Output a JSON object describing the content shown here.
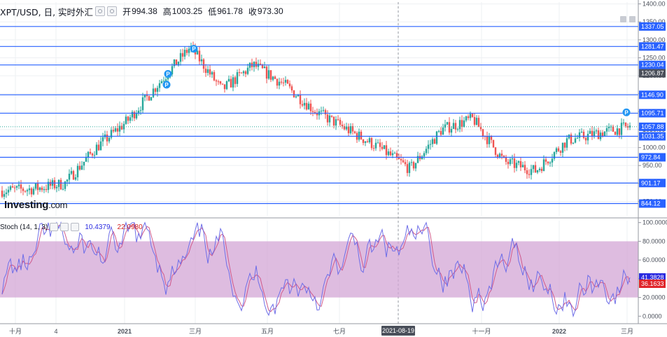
{
  "legend": {
    "symbol": "XPT/USD, 日, 实时外汇",
    "open_label": "开",
    "open": "994.38",
    "high_label": "高",
    "high": "1003.25",
    "low_label": "低",
    "low": "961.78",
    "close_label": "收",
    "close": "973.30"
  },
  "stoch_legend": {
    "name": "Stoch (14, 1, 3)",
    "k": "10.4379",
    "d": "22.0980"
  },
  "logo": {
    "brand": "Investing",
    "domain": ".com"
  },
  "colors": {
    "up": "#26a69a",
    "down": "#ef5350",
    "level": "#2962ff",
    "k_line": "#6e6ee8",
    "d_line": "#d05a8c",
    "band": "#d3a6d6"
  },
  "chart_data": [
    {
      "type": "candlestick",
      "title": "XPT/USD, 日, 实时外汇",
      "y_ticks": [
        850,
        900,
        950,
        1000,
        1050,
        1100,
        1150,
        1200,
        1250,
        1300,
        1350,
        1400
      ],
      "ylim": [
        810,
        1405
      ],
      "x_ticks": [
        "十月",
        "4",
        "2021",
        "三月",
        "五月",
        "七月",
        "2021-08-19",
        "十一月",
        "2022",
        "三月"
      ],
      "horizontal_levels": [
        1337.05,
        1281.47,
        1230.04,
        1146.9,
        1095.71,
        1031.35,
        972.84,
        901.17,
        844.12
      ],
      "last_price_labels": [
        1206.87,
        1057.88
      ],
      "approx_close_path": [
        {
          "x": "十月",
          "y": 880
        },
        {
          "x": "4",
          "y": 885
        },
        {
          "x": "",
          "y": 900
        },
        {
          "x": "",
          "y": 1000
        },
        {
          "x": "2021",
          "y": 1075
        },
        {
          "x": "",
          "y": 1180
        },
        {
          "x": "三月",
          "y": 1280
        },
        {
          "x": "",
          "y": 1160
        },
        {
          "x": "五月",
          "y": 1230
        },
        {
          "x": "",
          "y": 1175
        },
        {
          "x": "七月",
          "y": 1100
        },
        {
          "x": "",
          "y": 1050
        },
        {
          "x": "2021-08-19",
          "y": 1000
        },
        {
          "x": "",
          "y": 940
        },
        {
          "x": "",
          "y": 1050
        },
        {
          "x": "十一月",
          "y": 1080
        },
        {
          "x": "",
          "y": 960
        },
        {
          "x": "",
          "y": 935
        },
        {
          "x": "2022",
          "y": 1020
        },
        {
          "x": "",
          "y": 1040
        },
        {
          "x": "三月",
          "y": 1057.88
        }
      ]
    },
    {
      "type": "line",
      "title": "Stoch (14, 1, 3)",
      "y_ticks": [
        "100.0000",
        "80.0000",
        "60.0000",
        "40.0000",
        "20.0000",
        "0.0000"
      ],
      "ylim": [
        -8,
        102
      ],
      "band": [
        20,
        80
      ],
      "series": [
        {
          "name": "10.4379",
          "last": 41.3828
        },
        {
          "name": "22.0980",
          "last": 36.1633
        }
      ]
    }
  ]
}
